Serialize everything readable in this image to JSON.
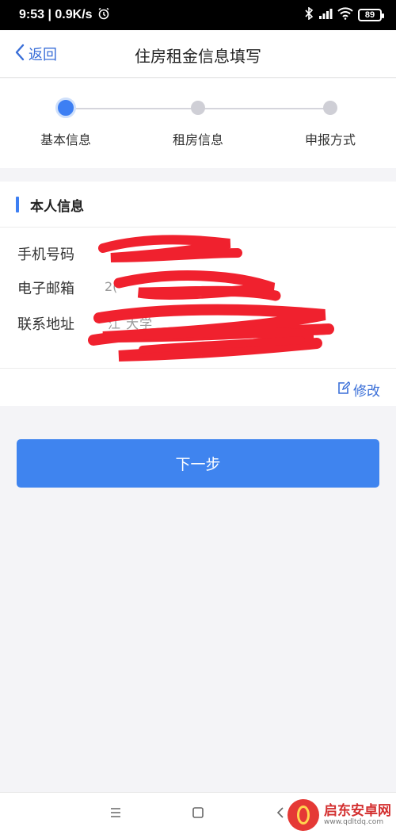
{
  "status_bar": {
    "time": "9:53 | 0.9K/s",
    "battery": "89"
  },
  "nav": {
    "back_label": "返回",
    "title": "住房租金信息填写"
  },
  "steps": [
    {
      "label": "基本信息",
      "active": true
    },
    {
      "label": "租房信息",
      "active": false
    },
    {
      "label": "申报方式",
      "active": false
    }
  ],
  "card": {
    "section_title": "本人信息",
    "fields": [
      {
        "label": "手机号码",
        "value": ""
      },
      {
        "label": "电子邮箱",
        "value": "2("
      },
      {
        "label": "联系地址",
        "value": "江 大学"
      }
    ],
    "edit_label": "修改"
  },
  "next_button": "下一步",
  "watermark": {
    "brand": "启东安卓网",
    "url": "www.qdltdq.com"
  },
  "colors": {
    "accent": "#3f84ef",
    "link": "#3a6fd8",
    "redaction": "#f0212e"
  }
}
